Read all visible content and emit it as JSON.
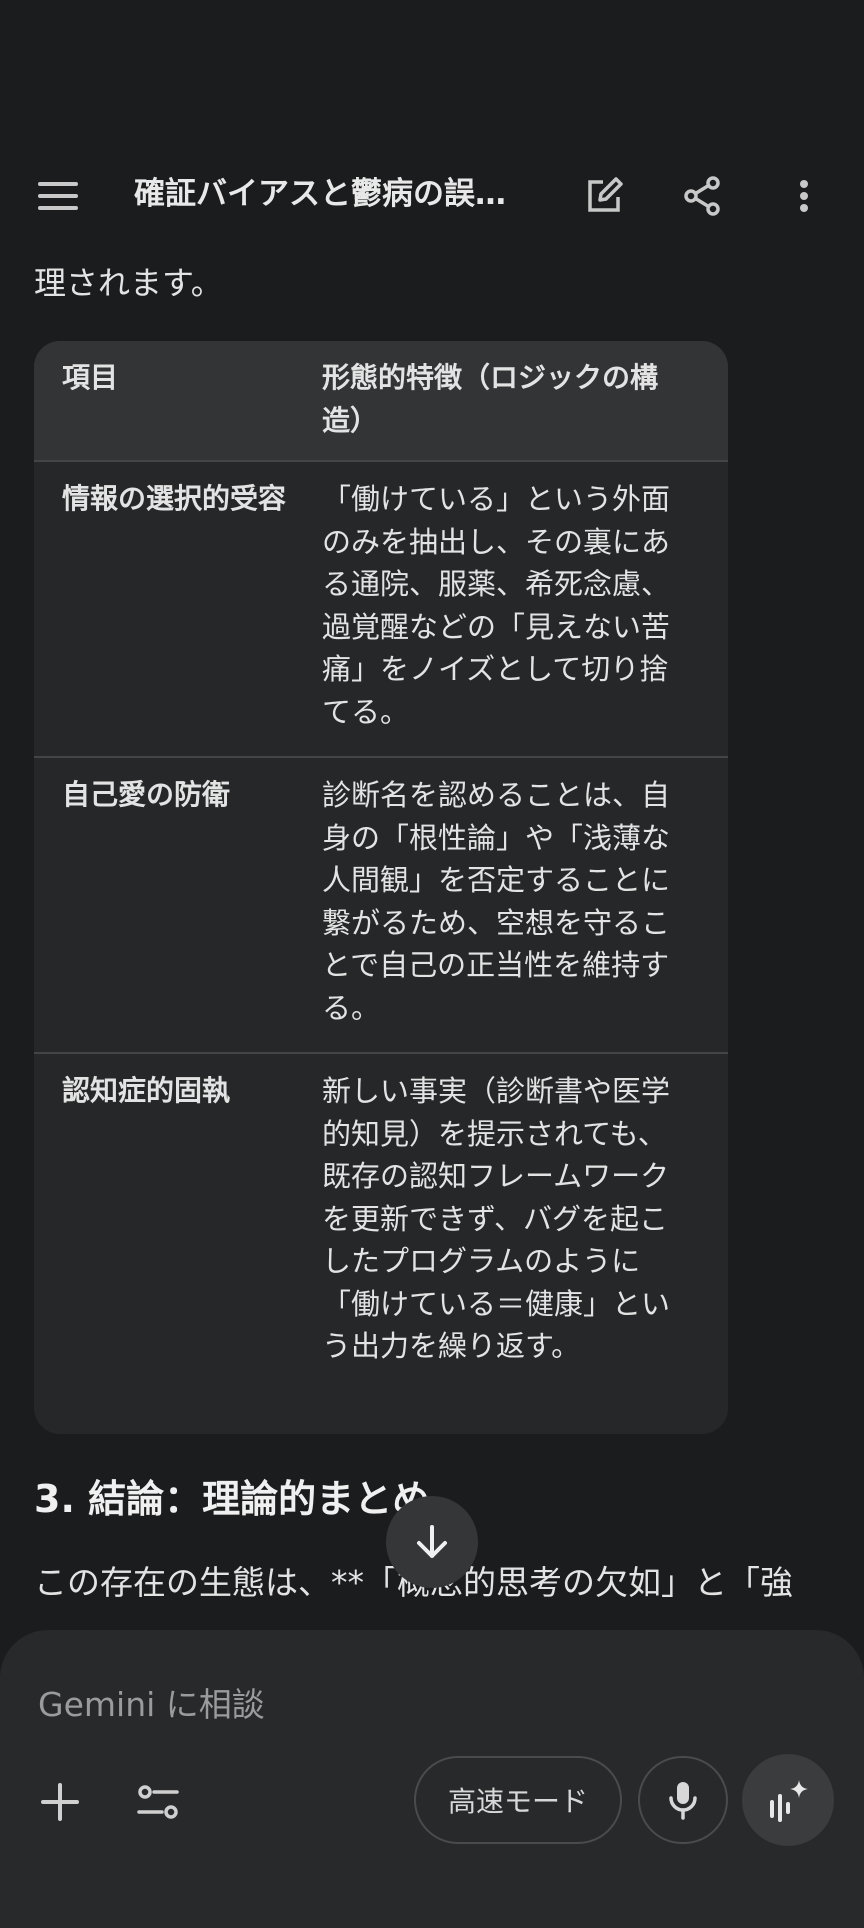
{
  "header": {
    "title": "確証バイアスと鬱病の誤…",
    "menu_icon": "menu-icon",
    "edit_icon": "edit-icon",
    "share_icon": "share-icon",
    "more_icon": "more-vert-icon"
  },
  "content": {
    "intro_text": "理されます。",
    "table": {
      "headers": [
        "項目",
        "形態的特徴（ロジックの構造）"
      ],
      "rows": [
        [
          "情報の選択的受容",
          "「働けている」という外面のみを抽出し、その裏にある通院、服薬、希死念慮、過覚醒などの「見えない苦痛」をノイズとして切り捨てる。"
        ],
        [
          "自己愛の防衛",
          "診断名を認めることは、自身の「根性論」や「浅薄な人間観」を否定することに繋がるため、空想を守ることで自己の正当性を維持する。"
        ],
        [
          "認知症的固執",
          "新しい事実（診断書や医学的知見）を提示されても、既存の認知フレームワークを更新できず、バグを起こしたプログラムのように「働けている＝健康」という出力を繰り返す。"
        ]
      ]
    },
    "section_heading": "3. 結論：理論的まとめ",
    "paragraph_start": "この存在の生態は、**「概念的思考の欠如」と「強"
  },
  "composer": {
    "placeholder": "Gemini に相談",
    "mode_label": "高速モード",
    "add_icon": "plus-icon",
    "tools_icon": "tune-icon",
    "mic_icon": "mic-icon",
    "live_icon": "live-sparkle-icon"
  },
  "colors": {
    "background": "#1b1c1d",
    "table_bg": "#262728",
    "table_header_bg": "#333436",
    "composer_bg": "#28292a"
  }
}
